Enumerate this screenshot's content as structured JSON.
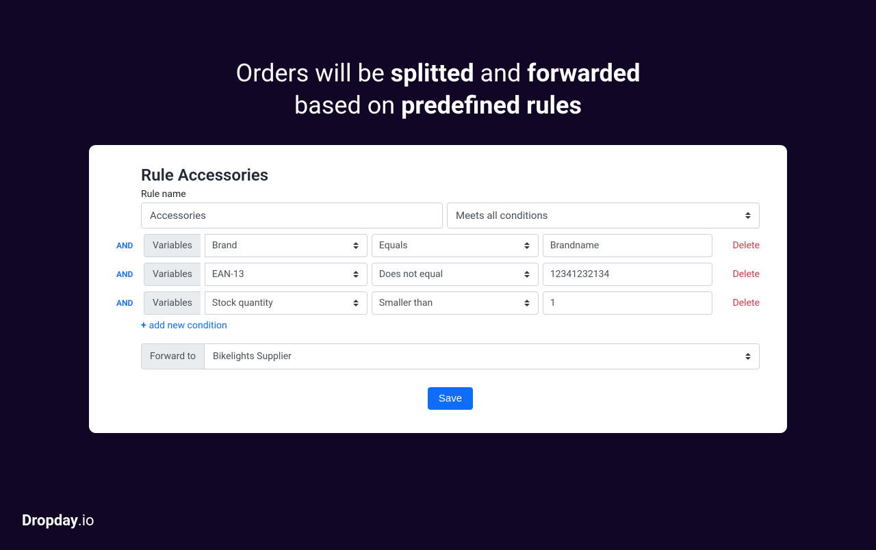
{
  "headline": {
    "part1": "Orders will be ",
    "b1": "splitted",
    "part2": " and ",
    "b2": "forwarded",
    "part3": "based on ",
    "b3": "predefined rules"
  },
  "card": {
    "title": "Rule Accessories",
    "rule_name_label": "Rule name",
    "rule_name_value": "Accessories",
    "match_mode": "Meets all conditions",
    "and_label": "AND",
    "variables_label": "Variables",
    "delete_label": "Delete",
    "conditions": [
      {
        "variable": "Brand",
        "operator": "Equals",
        "value": "Brandname"
      },
      {
        "variable": "EAN-13",
        "operator": "Does not equal",
        "value": "12341232134"
      },
      {
        "variable": "Stock quantity",
        "operator": "Smaller than",
        "value": "1"
      }
    ],
    "add_condition_label": "add new condition",
    "forward_to_label": "Forward to",
    "forward_to_value": "Bikelights Supplier",
    "save_label": "Save"
  },
  "brand": {
    "bold": "Dropday",
    "rest": ".io"
  }
}
